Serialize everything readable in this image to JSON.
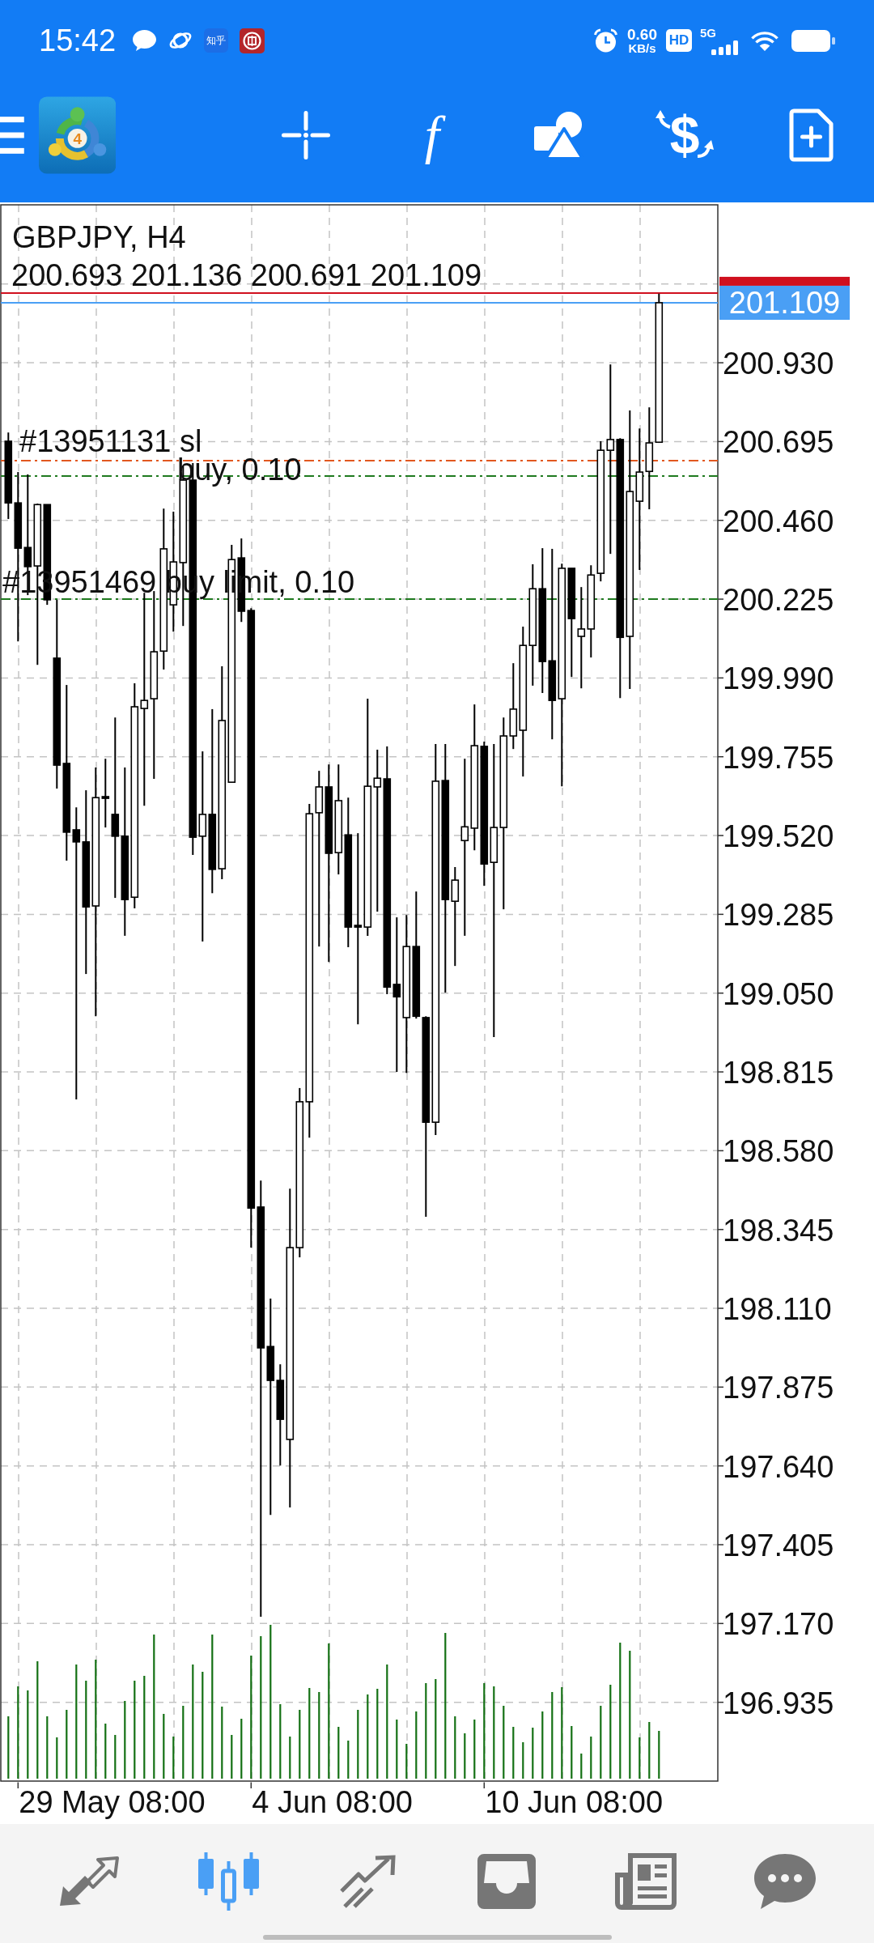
{
  "status_bar": {
    "time": "15:42",
    "app_icons": [
      {
        "kind": "chat"
      },
      {
        "kind": "orbit"
      },
      {
        "kind": "zhihu",
        "label": "知乎"
      },
      {
        "kind": "coin"
      }
    ],
    "net_speed": "0.60",
    "net_speed_unit": "KB/s",
    "hd_badge": "HD",
    "network": "5G"
  },
  "toolbar": {
    "logo_mark": "4",
    "tools": [
      {
        "kind": "crosshair"
      },
      {
        "kind": "function",
        "glyph": "f"
      },
      {
        "kind": "shapes"
      },
      {
        "kind": "trade",
        "glyph": "$"
      },
      {
        "kind": "new-document"
      }
    ]
  },
  "chart": {
    "symbol": "GBPJPY, H4",
    "ohlc": "200.693 201.136 200.691 201.109",
    "bid_tag": "201.109",
    "orders": [
      {
        "kind": "stop-loss",
        "label": "#13951131 sl"
      },
      {
        "kind": "open",
        "label": "buy, 0.10"
      },
      {
        "kind": "pending",
        "label": "#13951469 buy limit, 0.10"
      }
    ],
    "chart_data": {
      "type": "candlestick",
      "grid": true,
      "categories": [
        null,
        null,
        null,
        null,
        null,
        null,
        null,
        null,
        null,
        null,
        null,
        null,
        null,
        null,
        null,
        null,
        null,
        null,
        null,
        null,
        null,
        null,
        null,
        null,
        null,
        null,
        null,
        null,
        null,
        null,
        null,
        null,
        null,
        null,
        null,
        null,
        null,
        null,
        null,
        null,
        null,
        null,
        null,
        null,
        null,
        null,
        null,
        null,
        null,
        null,
        null,
        null,
        null,
        null,
        null,
        null,
        null,
        null,
        null,
        null,
        null,
        null,
        null,
        null,
        null,
        null,
        null,
        null
      ],
      "ohlc": [
        [
          200.696,
          200.722,
          200.464,
          200.512
        ],
        [
          200.512,
          200.604,
          200.099,
          200.377
        ],
        [
          200.379,
          200.597,
          200.237,
          200.322
        ],
        [
          200.324,
          200.51,
          200.029,
          200.507
        ],
        [
          200.507,
          200.507,
          200.208,
          200.223
        ],
        [
          200.049,
          200.223,
          199.66,
          199.73
        ],
        [
          199.735,
          199.969,
          199.445,
          199.53
        ],
        [
          199.537,
          199.604,
          198.733,
          199.501
        ],
        [
          199.501,
          199.655,
          199.107,
          199.307
        ],
        [
          199.31,
          199.723,
          198.981,
          199.633
        ],
        [
          199.636,
          199.749,
          199.544,
          199.631
        ],
        [
          199.583,
          199.872,
          199.334,
          199.518
        ],
        [
          199.518,
          199.723,
          199.221,
          199.329
        ],
        [
          199.336,
          199.974,
          199.303,
          199.904
        ],
        [
          199.899,
          200.244,
          199.609,
          199.923
        ],
        [
          199.928,
          200.249,
          199.689,
          200.068
        ],
        [
          200.07,
          200.495,
          200.015,
          200.375
        ],
        [
          200.208,
          200.486,
          200.128,
          200.336
        ],
        [
          200.334,
          200.623,
          200.145,
          200.58
        ],
        [
          200.58,
          200.631,
          199.462,
          199.515
        ],
        [
          199.518,
          199.771,
          199.204,
          199.583
        ],
        [
          199.583,
          199.897,
          199.348,
          199.419
        ],
        [
          199.421,
          200.025,
          199.39,
          199.863
        ],
        [
          199.679,
          200.387,
          199.679,
          200.343
        ],
        [
          200.348,
          200.406,
          200.157,
          200.189
        ],
        [
          200.191,
          200.198,
          198.291,
          198.409
        ],
        [
          198.412,
          198.491,
          197.19,
          197.992
        ],
        [
          197.996,
          198.139,
          197.494,
          197.895
        ],
        [
          197.895,
          197.943,
          197.641,
          197.779
        ],
        [
          197.719,
          198.467,
          197.516,
          198.291
        ],
        [
          198.291,
          198.767,
          198.262,
          198.726
        ],
        [
          198.726,
          199.614,
          198.619,
          199.585
        ],
        [
          199.588,
          199.713,
          199.189,
          199.665
        ],
        [
          199.665,
          199.732,
          199.143,
          199.467
        ],
        [
          199.469,
          199.732,
          199.404,
          199.624
        ],
        [
          199.522,
          199.633,
          199.187,
          199.247
        ],
        [
          199.252,
          199.527,
          198.957,
          199.247
        ],
        [
          199.247,
          199.928,
          199.221,
          199.667
        ],
        [
          199.665,
          199.776,
          199.293,
          199.691
        ],
        [
          199.689,
          199.786,
          199.047,
          199.068
        ],
        [
          199.076,
          199.276,
          198.815,
          199.039
        ],
        [
          198.977,
          199.283,
          198.812,
          199.189
        ],
        [
          199.189,
          199.353,
          198.974,
          198.981
        ],
        [
          198.977,
          198.981,
          198.383,
          198.665
        ],
        [
          198.665,
          199.793,
          198.627,
          199.682
        ],
        [
          199.684,
          199.793,
          199.052,
          199.329
        ],
        [
          199.324,
          199.426,
          199.131,
          199.387
        ],
        [
          199.505,
          199.749,
          199.221,
          199.546
        ],
        [
          199.542,
          199.911,
          199.476,
          199.788
        ],
        [
          199.786,
          199.8,
          199.37,
          199.435
        ],
        [
          199.44,
          199.793,
          198.919,
          199.544
        ],
        [
          199.544,
          199.872,
          199.3,
          199.817
        ],
        [
          199.817,
          200.034,
          199.778,
          199.897
        ],
        [
          199.834,
          200.143,
          199.696,
          200.087
        ],
        [
          200.087,
          200.329,
          199.967,
          200.256
        ],
        [
          200.256,
          200.377,
          199.945,
          200.039
        ],
        [
          200.041,
          200.375,
          199.807,
          199.923
        ],
        [
          199.928,
          200.331,
          199.667,
          200.317
        ],
        [
          200.317,
          200.317,
          199.993,
          200.167
        ],
        [
          200.114,
          200.261,
          199.959,
          200.136
        ],
        [
          200.136,
          200.326,
          200.051,
          200.297
        ],
        [
          200.302,
          200.696,
          200.278,
          200.669
        ],
        [
          200.669,
          200.925,
          200.36,
          200.701
        ],
        [
          200.701,
          200.705,
          199.93,
          200.111
        ],
        [
          200.114,
          200.788,
          199.957,
          200.546
        ],
        [
          200.517,
          200.734,
          200.312,
          200.604
        ],
        [
          200.606,
          200.797,
          200.493,
          200.691
        ],
        [
          200.693,
          201.136,
          200.691,
          201.109
        ]
      ],
      "ylim": [
        196.7,
        201.401
      ],
      "yticks": [
        {
          "value": 200.93,
          "label": "200.930"
        },
        {
          "value": 200.695,
          "label": "200.695"
        },
        {
          "value": 200.46,
          "label": "200.460"
        },
        {
          "value": 200.225,
          "label": "200.225"
        },
        {
          "value": 199.99,
          "label": "199.990"
        },
        {
          "value": 199.755,
          "label": "199.755"
        },
        {
          "value": 199.52,
          "label": "199.520"
        },
        {
          "value": 199.285,
          "label": "199.285"
        },
        {
          "value": 199.05,
          "label": "199.050"
        },
        {
          "value": 198.815,
          "label": "198.815"
        },
        {
          "value": 198.58,
          "label": "198.580"
        },
        {
          "value": 198.345,
          "label": "198.345"
        },
        {
          "value": 198.11,
          "label": "198.110"
        },
        {
          "value": 197.875,
          "label": "197.875"
        },
        {
          "value": 197.64,
          "label": "197.640"
        },
        {
          "value": 197.405,
          "label": "197.405"
        },
        {
          "value": 197.17,
          "label": "197.170"
        },
        {
          "value": 196.935,
          "label": "196.935"
        }
      ],
      "ref_lines": [
        {
          "axis": "y",
          "value": 201.138,
          "color": "#d0101e"
        },
        {
          "axis": "y",
          "value": 201.109,
          "color": "#4a9ff5"
        },
        {
          "axis": "y",
          "value": 200.638,
          "color": "#e2581f"
        },
        {
          "axis": "y",
          "value": 200.592,
          "color": "#1f7a1f"
        },
        {
          "axis": "y",
          "value": 200.225,
          "color": "#1f7a1f"
        }
      ]
    },
    "time_axis": [
      "29 May 08:00",
      "4 Jun 08:00",
      "10 Jun 08:00"
    ]
  },
  "bottom_nav": [
    {
      "kind": "arrows",
      "selected": false
    },
    {
      "kind": "candles",
      "selected": true
    },
    {
      "kind": "trend",
      "selected": false
    },
    {
      "kind": "tray",
      "selected": false
    },
    {
      "kind": "newspaper",
      "selected": false
    },
    {
      "kind": "chat",
      "selected": false
    }
  ]
}
